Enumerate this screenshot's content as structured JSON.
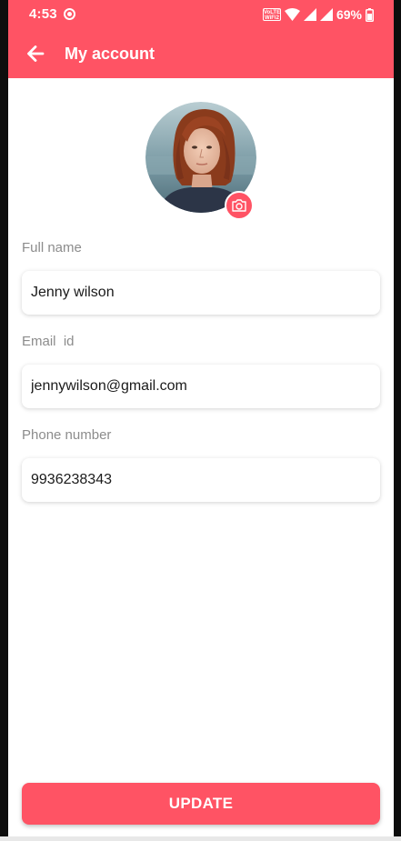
{
  "status_bar": {
    "time": "4:53",
    "network_badge": "VoLTE WiFi2",
    "battery_percent": "69%",
    "icons": [
      "screen-record-icon",
      "volte-wifi-icon",
      "wifi-icon",
      "signal-icon",
      "signal-icon",
      "battery-icon"
    ]
  },
  "header": {
    "title": "My account",
    "back_icon": "arrow-left-icon"
  },
  "profile": {
    "camera_icon": "camera-icon"
  },
  "form": {
    "full_name_label": "Full name",
    "full_name_value": "Jenny wilson",
    "email_label": "Email  id",
    "email_value": "jennywilson@gmail.com",
    "phone_label": "Phone number",
    "phone_value": "9936238343"
  },
  "actions": {
    "update_label": "UPDATE"
  },
  "colors": {
    "accent": "#ff5364",
    "label": "#8c8c8c",
    "text": "#1a1a1a",
    "background": "#ffffff"
  }
}
